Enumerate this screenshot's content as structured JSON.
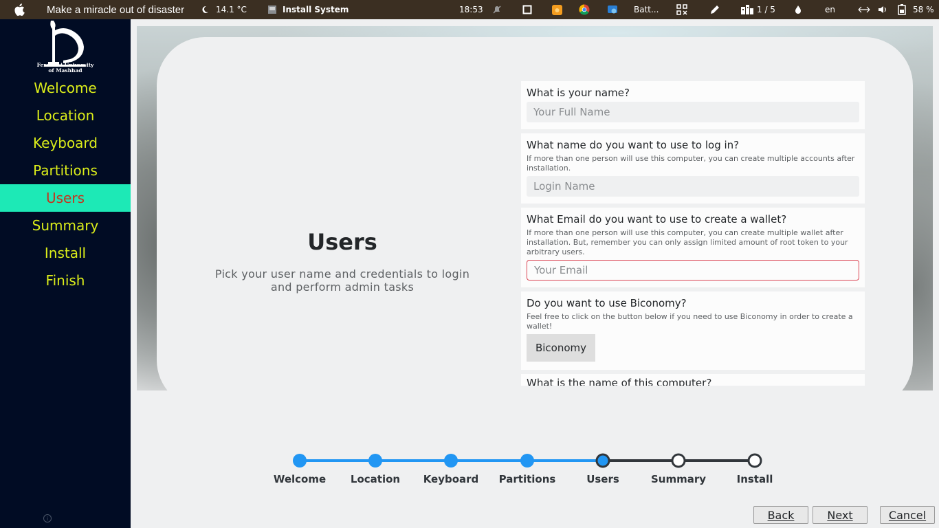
{
  "topbar": {
    "window_title": "Make a miracle out of disaster",
    "weather": "14.1 °C",
    "active_app": "Install System",
    "time": "18:53",
    "battery_app": "Batt...",
    "workspace": "1 / 5",
    "keyboard_layout": "en",
    "battery_percent": "58 %",
    "bg_color": "#3b2f22"
  },
  "sidebar": {
    "logo_text_line1": "Ferdowsi University",
    "logo_text_line2": "of Mashhad",
    "items": [
      {
        "label": "Welcome"
      },
      {
        "label": "Location"
      },
      {
        "label": "Keyboard"
      },
      {
        "label": "Partitions"
      },
      {
        "label": "Users",
        "active": true
      },
      {
        "label": "Summary"
      },
      {
        "label": "Install"
      },
      {
        "label": "Finish"
      }
    ],
    "text_color": "#dcee1a",
    "active_bg": "#1de9b6",
    "active_text": "#c5331d",
    "bg_color": "#010c24"
  },
  "page": {
    "title": "Users",
    "subtitle": "Pick your user name and credentials to login and perform admin tasks"
  },
  "form": {
    "name_question": "What is your name?",
    "name_placeholder": "Your Full Name",
    "login_question": "What name do you want to use to log in?",
    "login_hint": "If more than one person will use this computer, you can create multiple accounts after installation.",
    "login_placeholder": "Login Name",
    "email_question": "What Email do you want to use to create a wallet?",
    "email_hint": "If more than one person will use this computer, you can create multiple wallet after installation. But, remember you can only assign limited amount of root token to your arbitrary users.",
    "email_placeholder": "Your Email",
    "biconomy_question": "Do you want to use Biconomy?",
    "biconomy_hint": "Feel free to click on the button below if you need to use Biconomy in order to create a wallet!",
    "biconomy_button": "Biconomy",
    "computer_question": "What is the name of this computer?"
  },
  "progress": {
    "steps": [
      "Welcome",
      "Location",
      "Keyboard",
      "Partitions",
      "Users",
      "Summary",
      "Install"
    ],
    "completed_steps": 4,
    "current_step": 5,
    "accent": "#2196f3",
    "inactive": "#31363b"
  },
  "buttons": {
    "back": "Back",
    "next": "Next",
    "cancel": "Cancel"
  }
}
